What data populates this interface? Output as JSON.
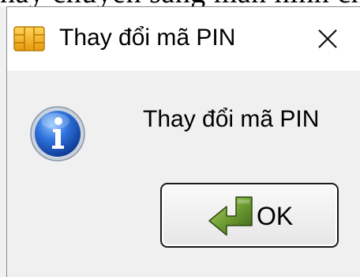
{
  "background_text": "nay chuyển sang màn hình chức năng",
  "dialog": {
    "title": "Thay đổi mã PIN",
    "close_symbol": "×",
    "message": "Thay đổi mã PIN",
    "icons": {
      "title": "smart-card-chip-icon",
      "message": "info-icon",
      "ok": "green-return-arrow-icon"
    },
    "buttons": {
      "ok": "OK"
    }
  },
  "colors": {
    "chip_gold": "#f2b21b",
    "info_blue": "#1a57c8",
    "arrow_green": "#5a8a2a"
  }
}
